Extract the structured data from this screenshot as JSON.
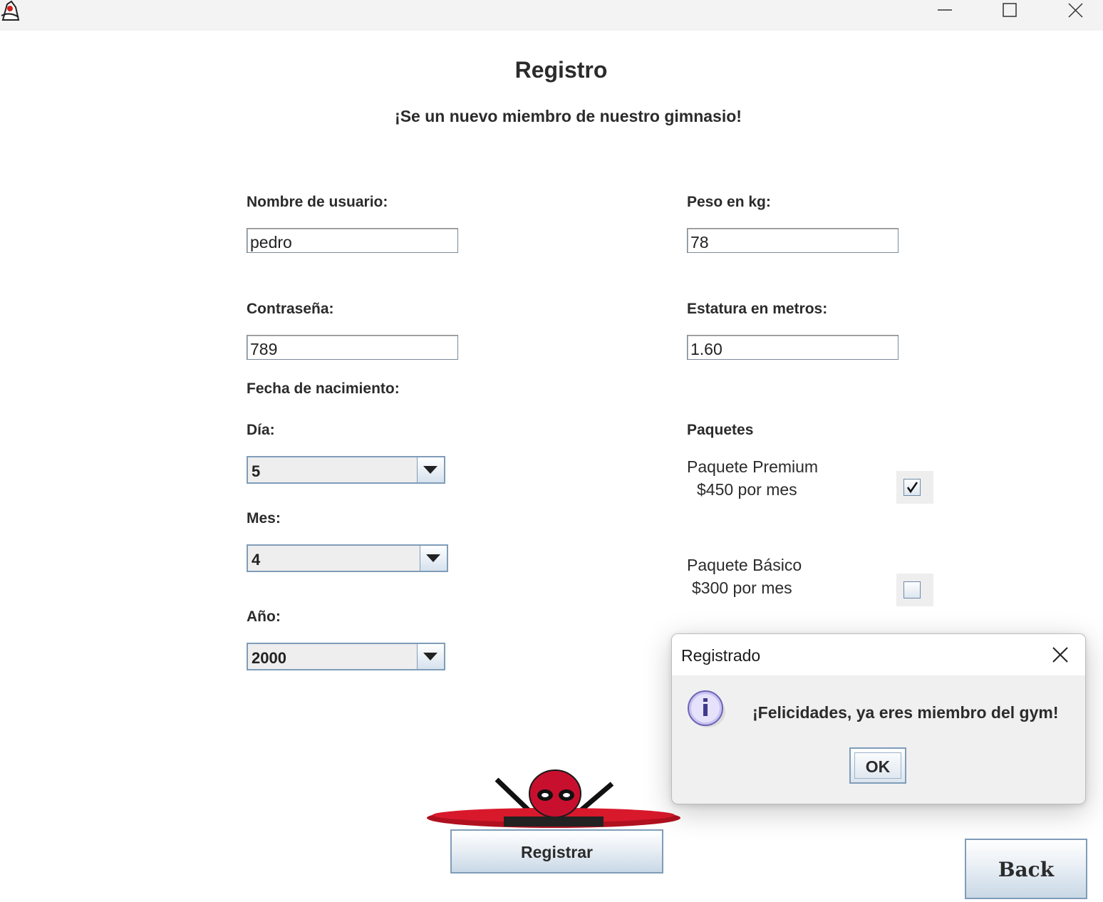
{
  "window": {
    "icon": "java-duke-icon",
    "controls": [
      "minimize-icon",
      "maximize-icon",
      "close-icon"
    ]
  },
  "form": {
    "title": "Registro",
    "subtitle": "¡Se un nuevo miembro de nuestro gimnasio!",
    "username_label": "Nombre de usuario:",
    "username_value": "pedro",
    "password_label": "Contraseña:",
    "password_value": "789",
    "weight_label": "Peso en kg:",
    "weight_value": "78",
    "height_label": "Estatura en metros:",
    "height_value": "1.60",
    "birthdate_label": "Fecha de nacimiento:",
    "day_label": "Día:",
    "day_value": "5",
    "month_label": "Mes:",
    "month_value": "4",
    "year_label": "Año:",
    "year_value": "2000",
    "packages_label": "Paquetes",
    "premium": {
      "name": "Paquete Premium",
      "price": "$450 por mes",
      "checked": true
    },
    "basic": {
      "name": "Paquete Básico",
      "price": "$300 por mes",
      "checked": false
    },
    "register_button": "Registrar",
    "back_button": "Back"
  },
  "dialog": {
    "title": "Registrado",
    "message": "¡Felicidades, ya eres miembro del gym!",
    "ok_button": "OK",
    "icon": "info-icon"
  },
  "colors": {
    "titlebar": "#f3f3f3",
    "dialog_bg": "#f0f0f0",
    "combo_border": "#7f9db9",
    "mascot_red": "#c8102e"
  }
}
